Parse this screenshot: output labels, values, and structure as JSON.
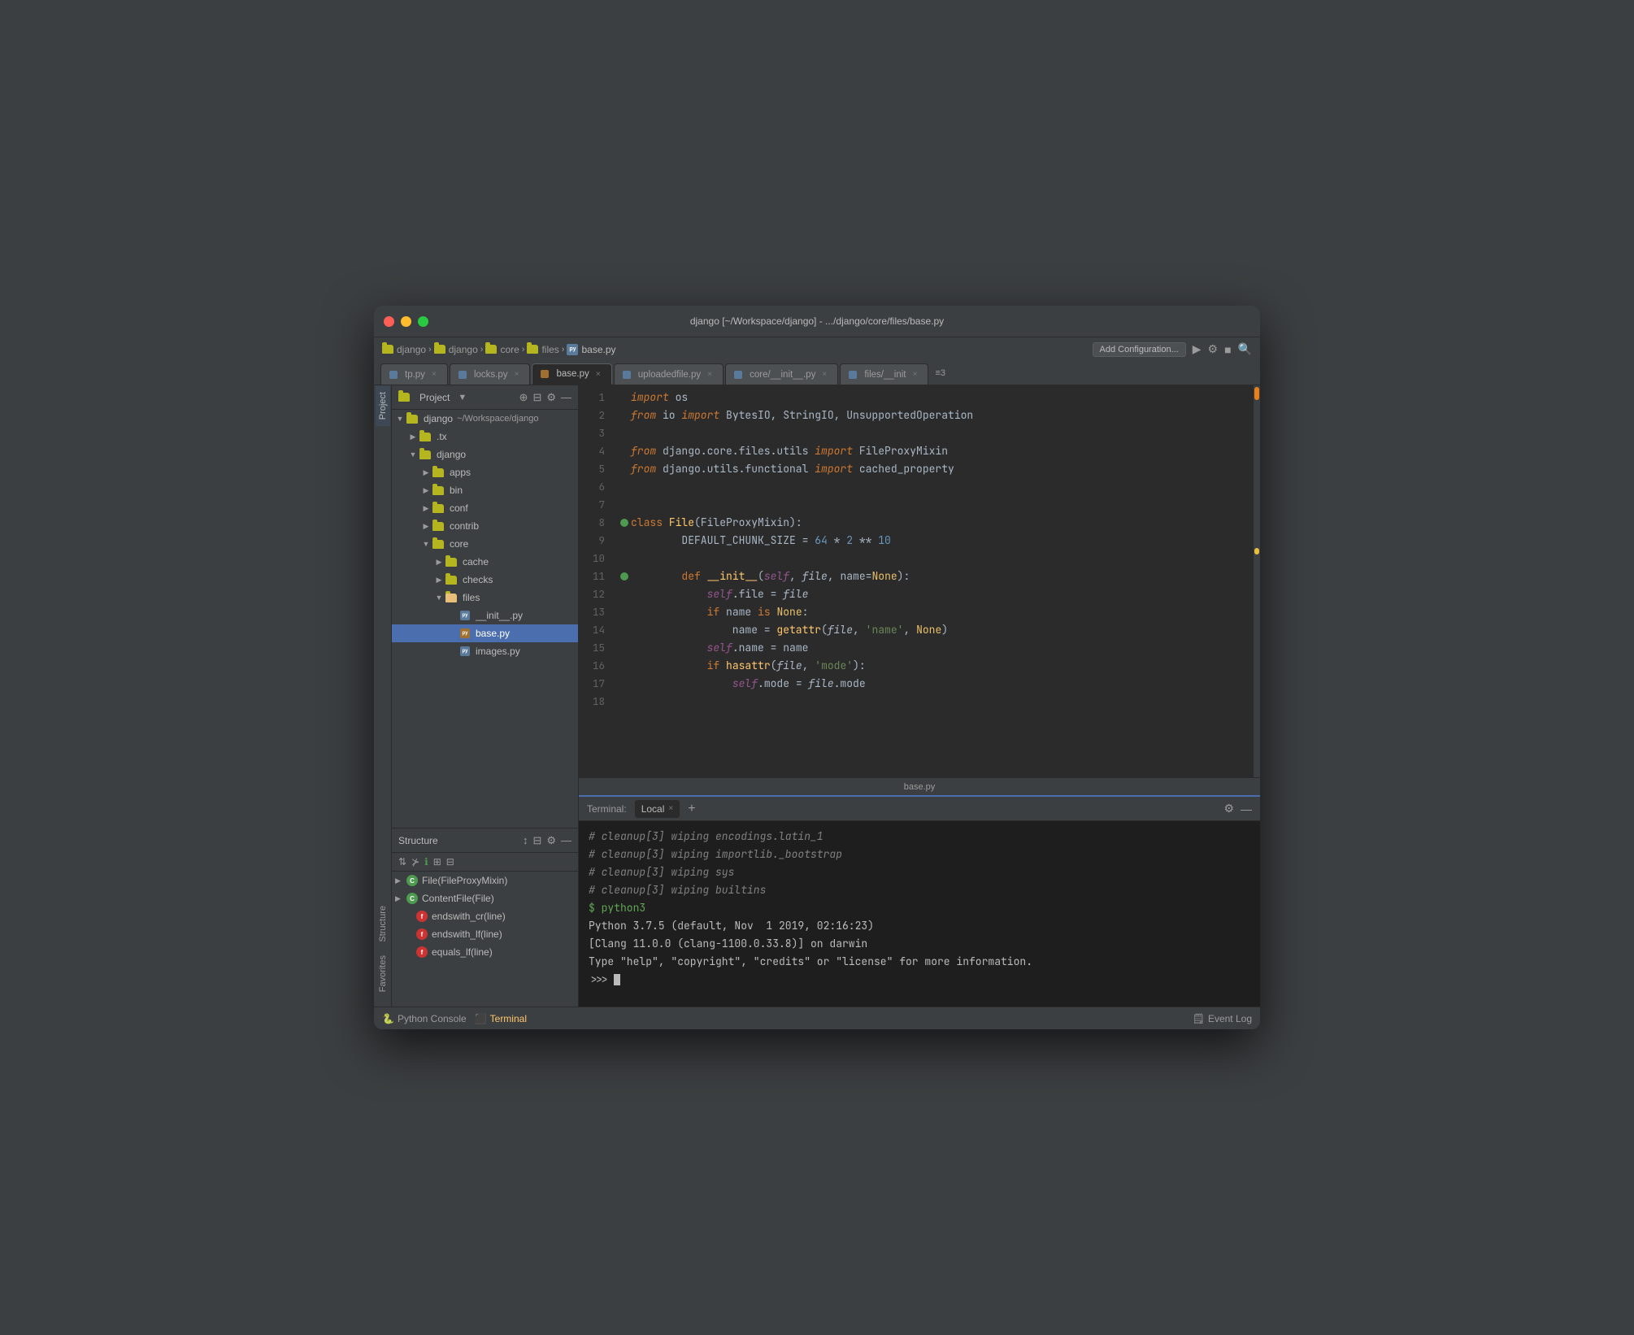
{
  "window": {
    "title": "django [~/Workspace/django] - .../django/core/files/base.py",
    "traffic_lights": [
      "red",
      "yellow",
      "green"
    ]
  },
  "breadcrumb": {
    "items": [
      {
        "label": "django",
        "type": "folder"
      },
      {
        "label": "django",
        "type": "folder"
      },
      {
        "label": "core",
        "type": "folder"
      },
      {
        "label": "files",
        "type": "folder"
      },
      {
        "label": "base.py",
        "type": "file"
      }
    ],
    "separator": "›",
    "config_button": "Add Configuration...",
    "actions": [
      "play",
      "settings",
      "stop",
      "search"
    ]
  },
  "tabs": [
    {
      "label": "tp.py",
      "active": false,
      "closable": true
    },
    {
      "label": "locks.py",
      "active": false,
      "closable": true
    },
    {
      "label": "base.py",
      "active": true,
      "closable": true
    },
    {
      "label": "uploadedfile.py",
      "active": false,
      "closable": true
    },
    {
      "label": "core/__init__.py",
      "active": false,
      "closable": true
    },
    {
      "label": "files/__init",
      "active": false,
      "closable": true
    },
    {
      "label": "≡3",
      "active": false,
      "closable": false
    }
  ],
  "sidebar": {
    "title": "Project",
    "root": "django",
    "root_path": "~/Workspace/django",
    "tree": [
      {
        "indent": 0,
        "label": "django",
        "path": "~/Workspace/django",
        "expanded": true,
        "type": "folder"
      },
      {
        "indent": 1,
        "label": ".tx",
        "expanded": false,
        "type": "folder"
      },
      {
        "indent": 1,
        "label": "django",
        "expanded": true,
        "type": "folder"
      },
      {
        "indent": 2,
        "label": "apps",
        "expanded": false,
        "type": "folder"
      },
      {
        "indent": 2,
        "label": "bin",
        "expanded": false,
        "type": "folder"
      },
      {
        "indent": 2,
        "label": "conf",
        "expanded": false,
        "type": "folder"
      },
      {
        "indent": 2,
        "label": "contrib",
        "expanded": false,
        "type": "folder"
      },
      {
        "indent": 2,
        "label": "core",
        "expanded": true,
        "type": "folder"
      },
      {
        "indent": 3,
        "label": "cache",
        "expanded": false,
        "type": "folder"
      },
      {
        "indent": 3,
        "label": "checks",
        "expanded": false,
        "type": "folder"
      },
      {
        "indent": 3,
        "label": "files",
        "expanded": true,
        "type": "folder"
      },
      {
        "indent": 4,
        "label": "__init__.py",
        "type": "file",
        "selected": false
      },
      {
        "indent": 4,
        "label": "base.py",
        "type": "file",
        "selected": true
      },
      {
        "indent": 4,
        "label": "images.py",
        "type": "file",
        "selected": false
      }
    ]
  },
  "structure": {
    "title": "Structure",
    "items": [
      {
        "label": "File(FileProxyMixin)",
        "type": "class",
        "expanded": false
      },
      {
        "label": "ContentFile(File)",
        "type": "class",
        "expanded": false
      },
      {
        "label": "endswith_cr(line)",
        "type": "func"
      },
      {
        "label": "endswith_lf(line)",
        "type": "func"
      },
      {
        "label": "equals_lf(line)",
        "type": "func"
      }
    ]
  },
  "code": {
    "filename": "base.py",
    "lines": [
      {
        "n": 1,
        "tokens": [
          {
            "t": "kw",
            "v": "import"
          },
          {
            "t": "normal",
            "v": " os"
          }
        ]
      },
      {
        "n": 2,
        "tokens": [
          {
            "t": "kw",
            "v": "from"
          },
          {
            "t": "normal",
            "v": " io "
          },
          {
            "t": "kw",
            "v": "import"
          },
          {
            "t": "normal",
            "v": " BytesIO, StringIO, UnsupportedOperation"
          }
        ]
      },
      {
        "n": 3,
        "tokens": []
      },
      {
        "n": 4,
        "tokens": [
          {
            "t": "kw",
            "v": "from"
          },
          {
            "t": "normal",
            "v": " django.core.files.utils "
          },
          {
            "t": "kw",
            "v": "import"
          },
          {
            "t": "normal",
            "v": " FileProxyMixin"
          }
        ]
      },
      {
        "n": 5,
        "tokens": [
          {
            "t": "kw",
            "v": "from"
          },
          {
            "t": "normal",
            "v": " django.utils.functional "
          },
          {
            "t": "kw",
            "v": "import"
          },
          {
            "t": "normal",
            "v": " cached_property"
          }
        ]
      },
      {
        "n": 6,
        "tokens": []
      },
      {
        "n": 7,
        "tokens": []
      },
      {
        "n": 8,
        "tokens": [
          {
            "t": "kw2",
            "v": "class"
          },
          {
            "t": "normal",
            "v": " "
          },
          {
            "t": "cls",
            "v": "File"
          },
          {
            "t": "normal",
            "v": "("
          },
          {
            "t": "normal",
            "v": "FileProxyMixin"
          },
          {
            "t": "normal",
            "v": "):"
          }
        ],
        "breakpoint": true
      },
      {
        "n": 9,
        "tokens": [
          {
            "t": "normal",
            "v": "        DEFAULT_CHUNK_SIZE = "
          },
          {
            "t": "num",
            "v": "64"
          },
          {
            "t": "normal",
            "v": " * "
          },
          {
            "t": "num",
            "v": "2"
          },
          {
            "t": "normal",
            "v": " ** "
          },
          {
            "t": "num",
            "v": "10"
          }
        ]
      },
      {
        "n": 10,
        "tokens": []
      },
      {
        "n": 11,
        "tokens": [
          {
            "t": "normal",
            "v": "        "
          },
          {
            "t": "kw2",
            "v": "def"
          },
          {
            "t": "normal",
            "v": " "
          },
          {
            "t": "func",
            "v": "__init__"
          },
          {
            "t": "normal",
            "v": "("
          },
          {
            "t": "self-kw",
            "v": "self"
          },
          {
            "t": "normal",
            "v": ", "
          },
          {
            "t": "param",
            "v": "file"
          },
          {
            "t": "normal",
            "v": ", name="
          },
          {
            "t": "kw3",
            "v": "None"
          },
          {
            "t": "normal",
            "v": "):"
          }
        ],
        "breakpoint": true
      },
      {
        "n": 12,
        "tokens": [
          {
            "t": "normal",
            "v": "            "
          },
          {
            "t": "self-kw",
            "v": "self"
          },
          {
            "t": "normal",
            "v": "."
          },
          {
            "t": "normal",
            "v": "file = "
          },
          {
            "t": "param",
            "v": "file"
          }
        ]
      },
      {
        "n": 13,
        "tokens": [
          {
            "t": "normal",
            "v": "            "
          },
          {
            "t": "kw2",
            "v": "if"
          },
          {
            "t": "normal",
            "v": " name "
          },
          {
            "t": "kw2",
            "v": "is"
          },
          {
            "t": "normal",
            "v": " "
          },
          {
            "t": "kw3",
            "v": "None"
          },
          {
            "t": "normal",
            "v": ":"
          }
        ]
      },
      {
        "n": 14,
        "tokens": [
          {
            "t": "normal",
            "v": "                name = "
          },
          {
            "t": "func",
            "v": "getattr"
          },
          {
            "t": "normal",
            "v": "("
          },
          {
            "t": "param",
            "v": "file"
          },
          {
            "t": "normal",
            "v": ", "
          },
          {
            "t": "str",
            "v": "'name'"
          },
          {
            "t": "normal",
            "v": ", "
          },
          {
            "t": "kw3",
            "v": "None"
          },
          {
            "t": "normal",
            "v": ")"
          }
        ]
      },
      {
        "n": 15,
        "tokens": [
          {
            "t": "normal",
            "v": "            "
          },
          {
            "t": "self-kw",
            "v": "self"
          },
          {
            "t": "normal",
            "v": ".name = name"
          }
        ]
      },
      {
        "n": 16,
        "tokens": [
          {
            "t": "normal",
            "v": "            "
          },
          {
            "t": "kw2",
            "v": "if"
          },
          {
            "t": "normal",
            "v": " "
          },
          {
            "t": "func",
            "v": "hasattr"
          },
          {
            "t": "normal",
            "v": "("
          },
          {
            "t": "param",
            "v": "file"
          },
          {
            "t": "normal",
            "v": ", "
          },
          {
            "t": "str",
            "v": "'mode'"
          },
          {
            "t": "normal",
            "v": "):"
          }
        ]
      },
      {
        "n": 17,
        "tokens": [
          {
            "t": "normal",
            "v": "                "
          },
          {
            "t": "self-kw",
            "v": "self"
          },
          {
            "t": "normal",
            "v": ".mode = "
          },
          {
            "t": "param",
            "v": "file"
          },
          {
            "t": "normal",
            "v": ".mode"
          }
        ]
      },
      {
        "n": 18,
        "tokens": []
      }
    ]
  },
  "terminal": {
    "tab_label": "Terminal:",
    "tab_name": "Local",
    "lines": [
      "# cleanup[3] wiping encodings.latin_1",
      "# cleanup[3] wiping importlib._bootstrap",
      "# cleanup[3] wiping sys",
      "# cleanup[3] wiping builtins",
      "$ python3",
      "Python 3.7.5 (default, Nov  1 2019, 02:16:23)",
      "[Clang 11.0.0 (clang-1100.0.33.8)] on darwin",
      "Type \"help\", \"copyright\", \"credits\" or \"license\" for more information.",
      ">>> "
    ]
  },
  "bottom_bar": {
    "python_console": "Python Console",
    "terminal": "Terminal",
    "event_log": "Event Log"
  },
  "side_tabs": {
    "left": [
      "Project",
      "Structure",
      "Favorites"
    ],
    "right": []
  }
}
